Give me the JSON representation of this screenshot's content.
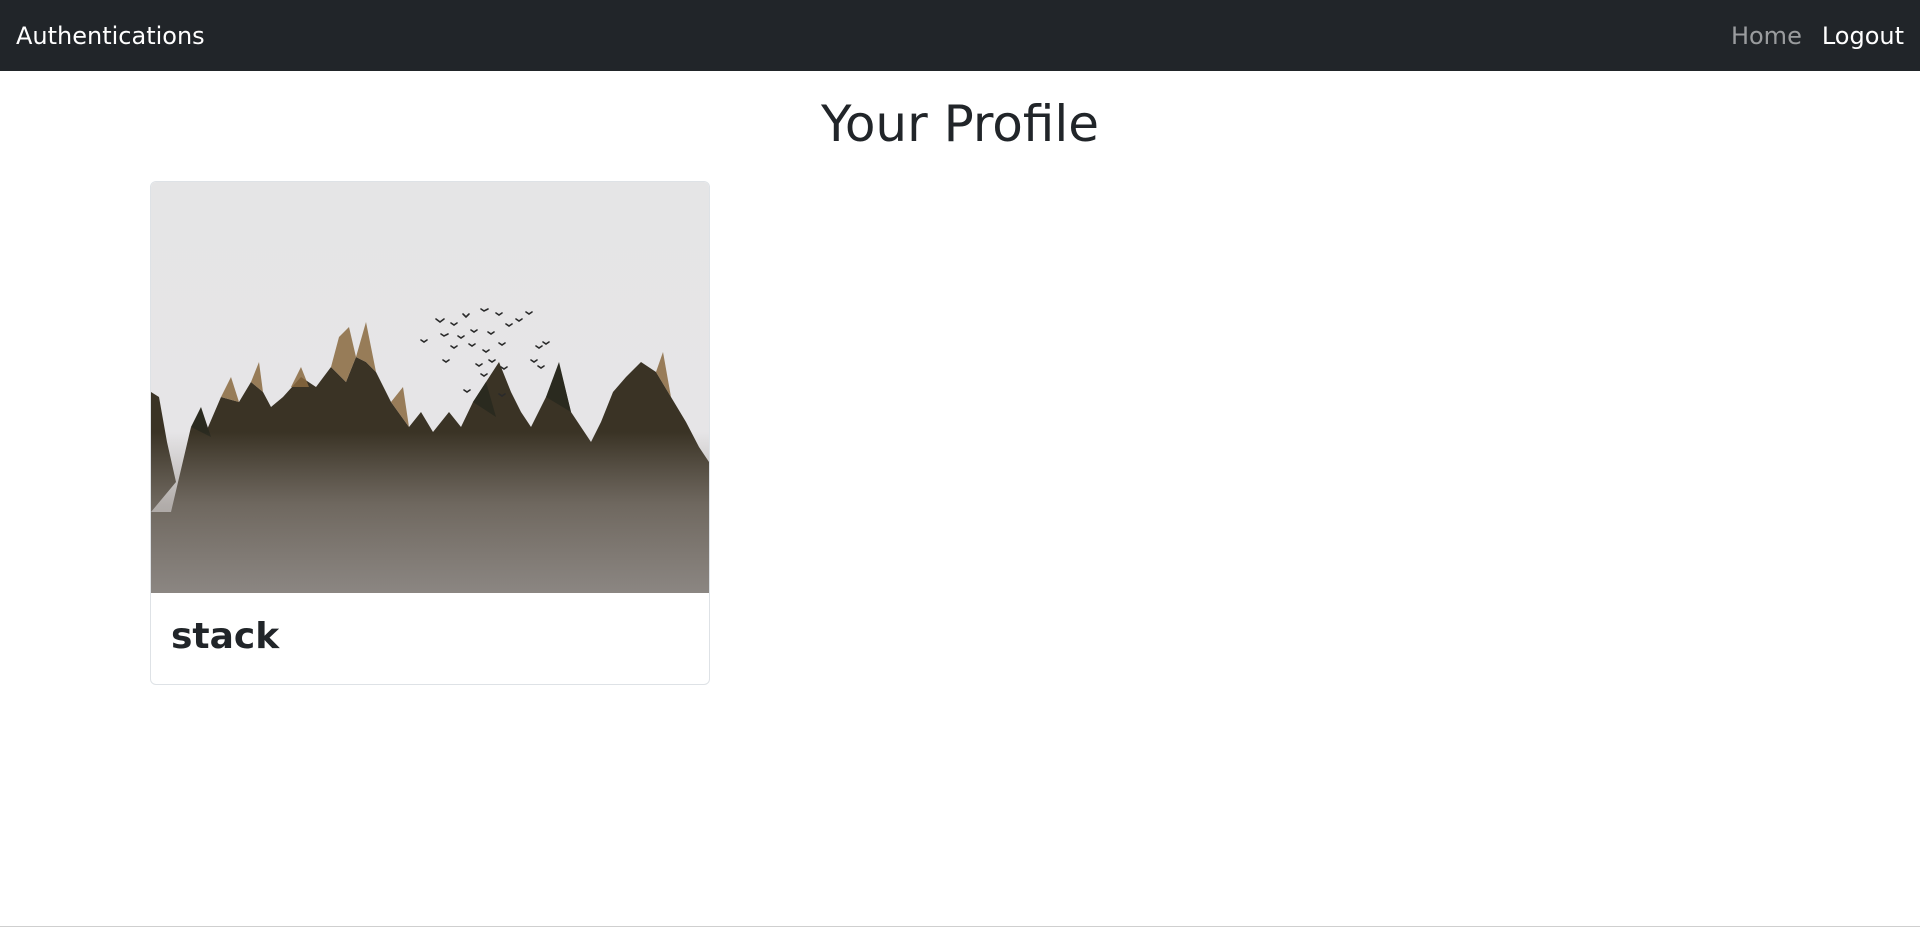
{
  "navbar": {
    "brand": "Authentications",
    "links": [
      {
        "label": "Home"
      },
      {
        "label": "Logout"
      }
    ],
    "background": "#212529"
  },
  "page": {
    "title": "Your Profile"
  },
  "cards": [
    {
      "title": "stack",
      "image": "misty-forest-with-birds"
    }
  ]
}
